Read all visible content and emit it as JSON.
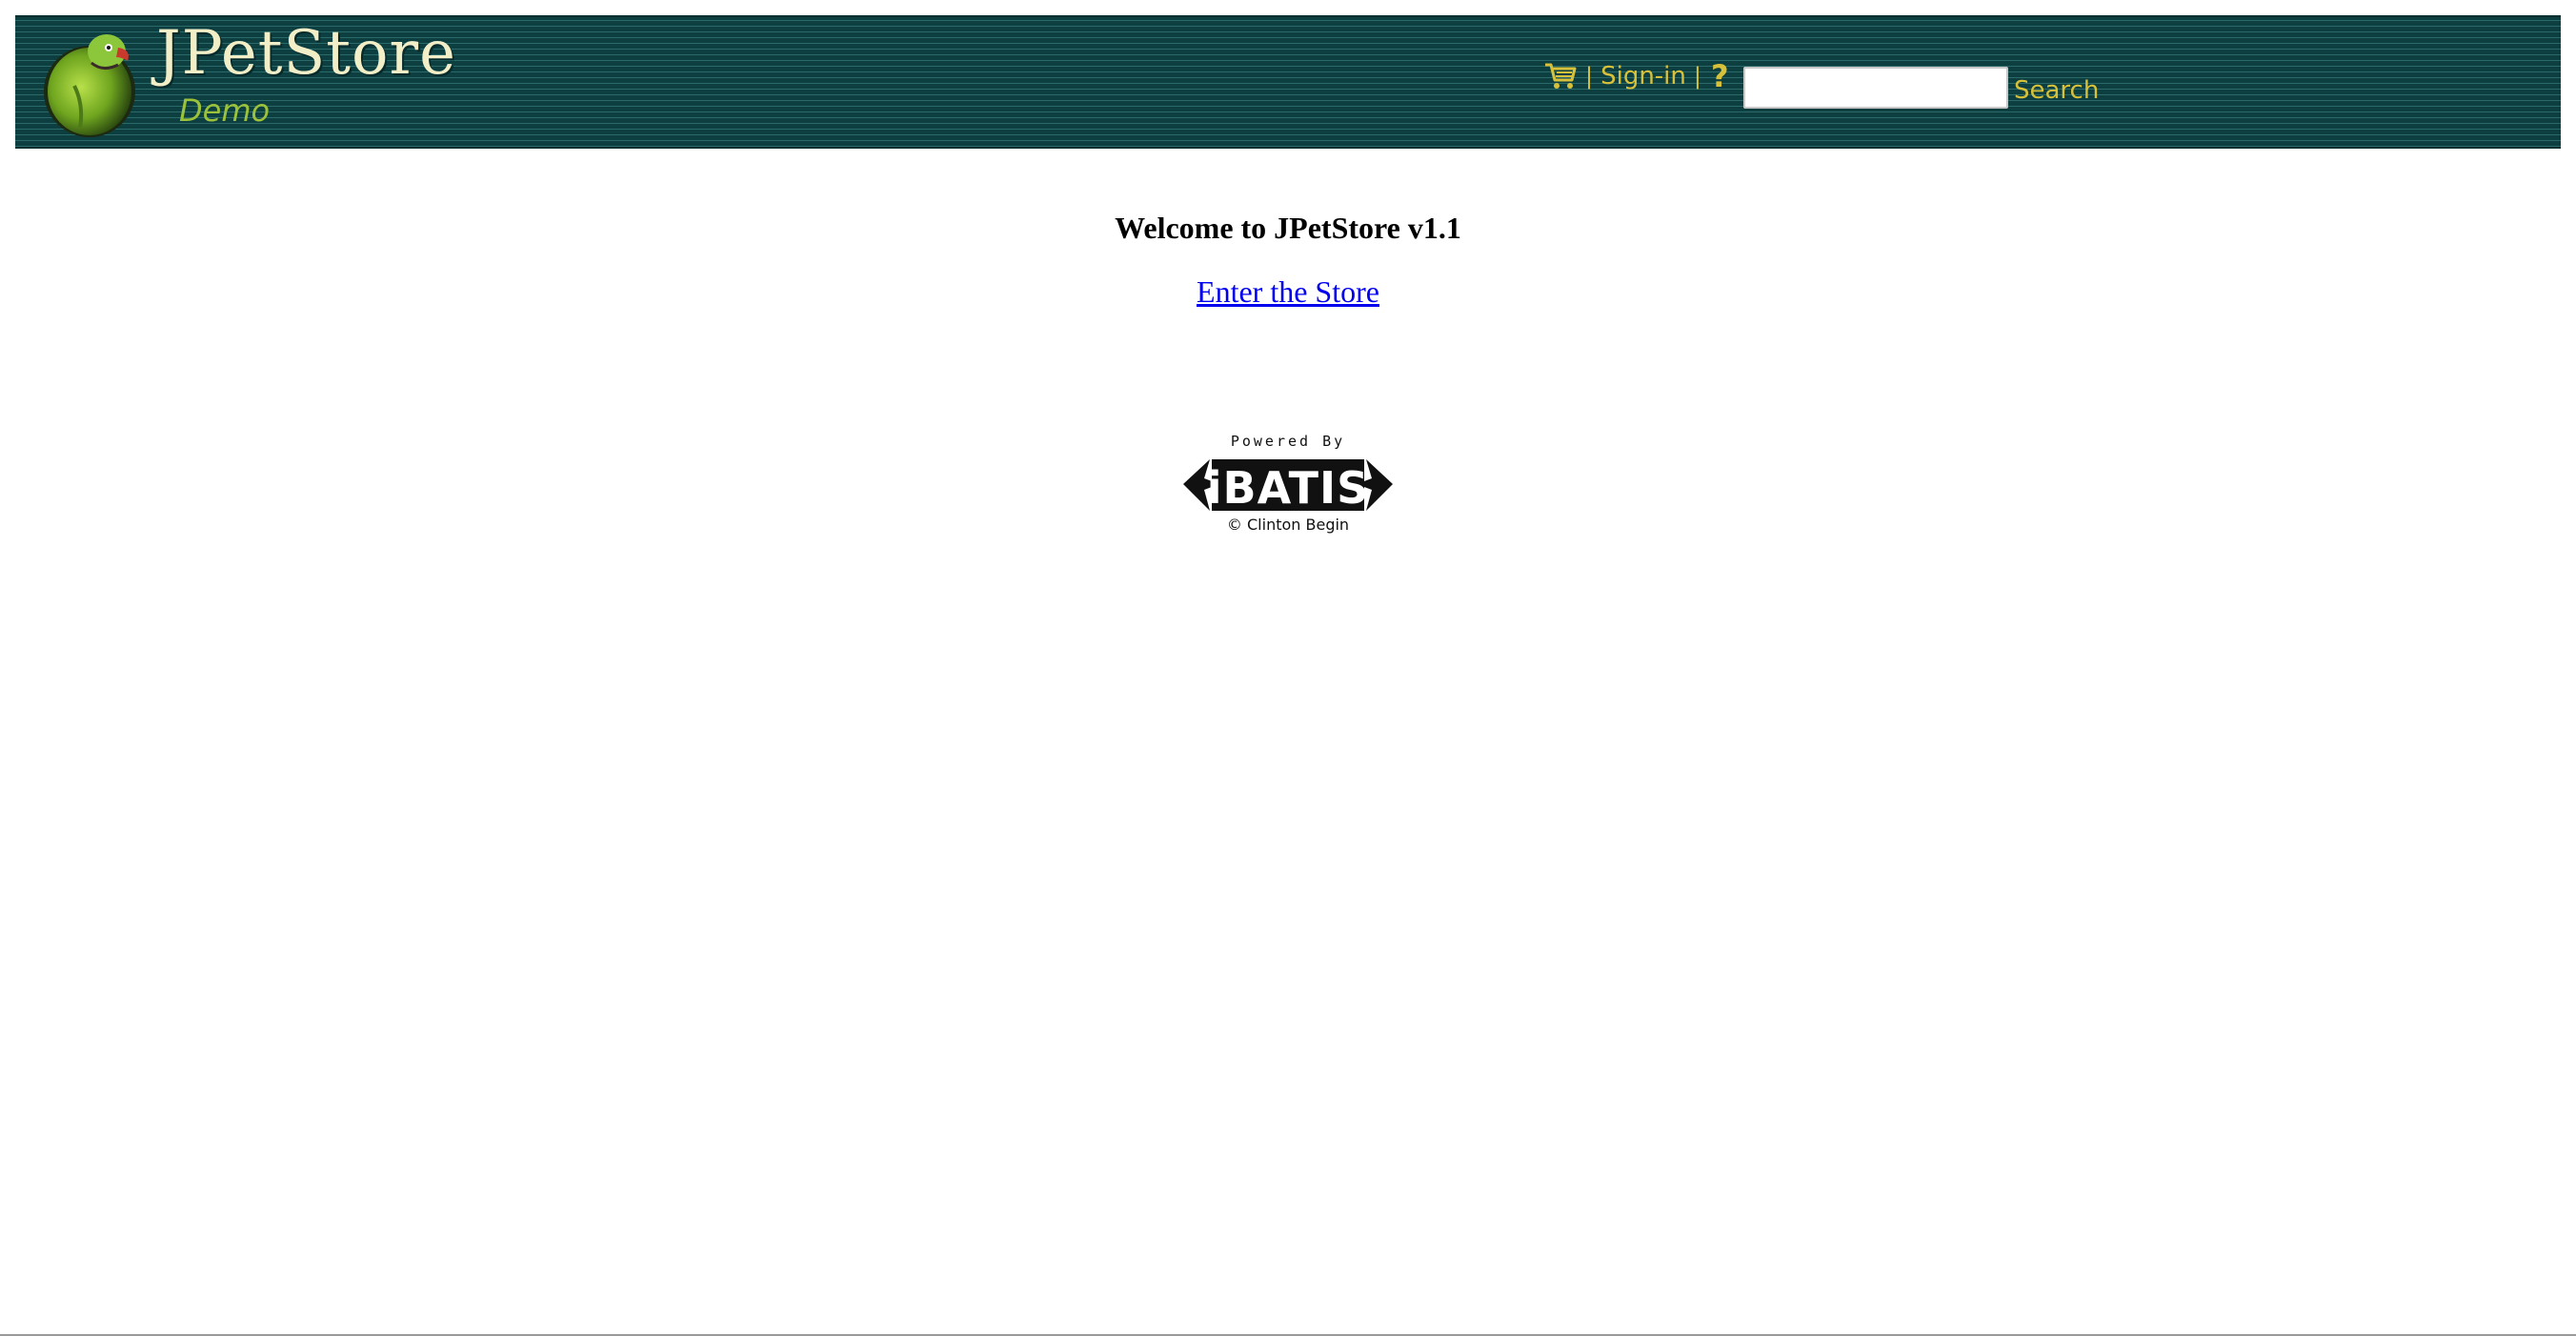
{
  "header": {
    "logo_title": "JPetStore",
    "logo_subtitle": "Demo",
    "nav": {
      "separator": "|",
      "signin_label": "Sign-in",
      "help_label": "?"
    },
    "search": {
      "value": "",
      "placeholder": "",
      "button_label": "Search"
    },
    "icons": {
      "logo": "parrot-logo-icon",
      "cart": "shopping-cart-icon"
    }
  },
  "main": {
    "welcome_heading": "Welcome to JPetStore v1.1",
    "enter_link": "Enter the Store"
  },
  "footer_badge": {
    "powered_by": "Powered By",
    "brand": "iBATIS",
    "credit": "© Clinton Begin"
  },
  "colors": {
    "banner": "#0f4547",
    "nav_text": "#d7c13a",
    "logo_title": "#f2eec8",
    "logo_subtitle": "#9bc23a",
    "link": "#0000ee"
  }
}
